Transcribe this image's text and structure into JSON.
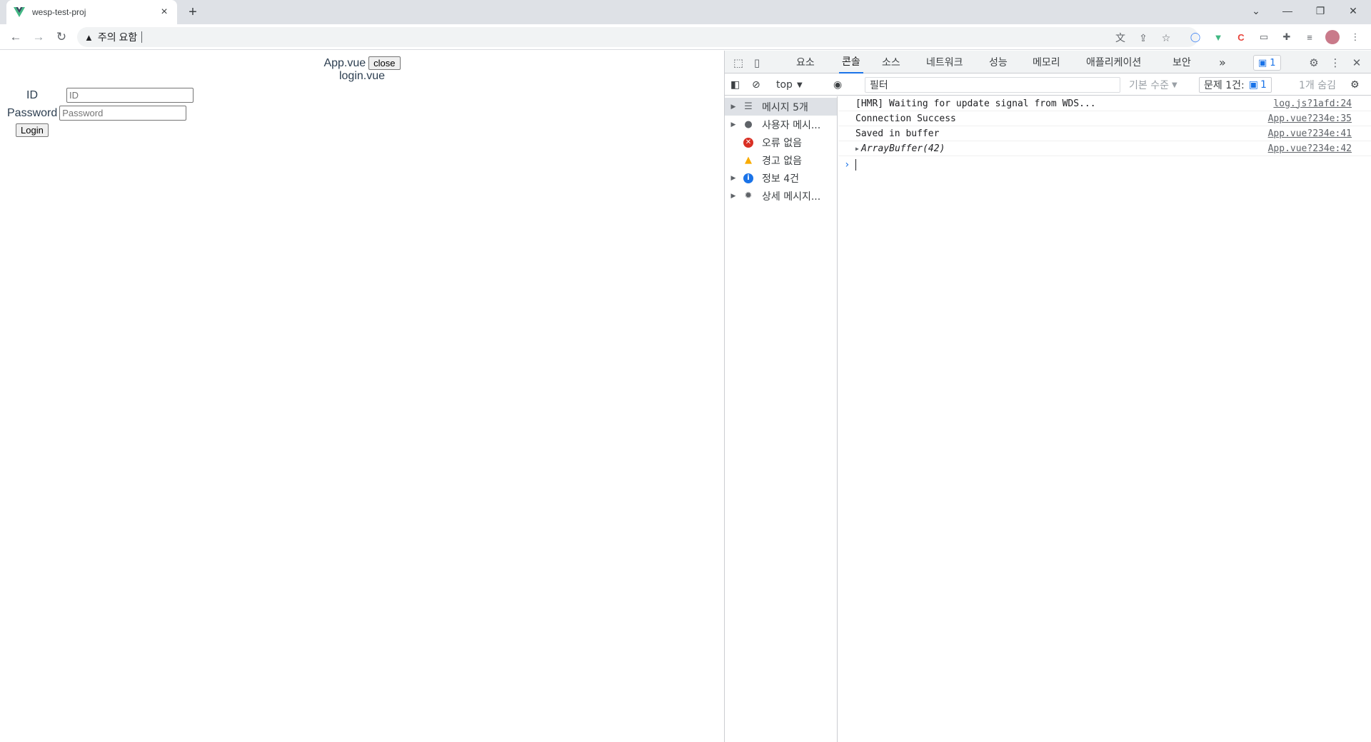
{
  "browser": {
    "tab_title": "wesp-test-proj",
    "new_tab_label": "+",
    "omnibox_warning": "주의 요함",
    "omnibox_url": ""
  },
  "page": {
    "app_title": "App.vue",
    "close_label": "close",
    "subtitle": "login.vue",
    "id_label": "ID",
    "id_placeholder": "ID",
    "password_label": "Password",
    "password_placeholder": "Password",
    "login_label": "Login"
  },
  "devtools": {
    "tabs": [
      "요소",
      "콘솔",
      "소스",
      "네트워크",
      "성능",
      "메모리",
      "애플리케이션",
      "보안"
    ],
    "active_tab": "콘솔",
    "more_tabs": "»",
    "issues_badge_count": "1",
    "filterbar": {
      "context": "top",
      "filter_placeholder": "필터",
      "level": "기본 수준",
      "issues_label": "문제 1건:",
      "issues_count": "1",
      "hidden": "1개 숨김"
    },
    "sidebar": [
      {
        "label": "메시지 5개",
        "icon": "list-icon",
        "expandable": true,
        "selected": true
      },
      {
        "label": "사용자 메시...",
        "icon": "user-icon",
        "expandable": true,
        "selected": false
      },
      {
        "label": "오류 없음",
        "icon": "error-icon",
        "expandable": false,
        "selected": false
      },
      {
        "label": "경고 없음",
        "icon": "warning-icon",
        "expandable": false,
        "selected": false
      },
      {
        "label": "정보 4건",
        "icon": "info-icon",
        "expandable": true,
        "selected": false
      },
      {
        "label": "상세 메시지...",
        "icon": "bug-icon",
        "expandable": true,
        "selected": false
      }
    ],
    "logs": [
      {
        "message": "[HMR] Waiting for update signal from WDS...",
        "source": "log.js?1afd:24"
      },
      {
        "message": "Connection Success",
        "source": "App.vue?234e:35"
      },
      {
        "message": "Saved in buffer",
        "source": "App.vue?234e:41"
      },
      {
        "message": "ArrayBuffer(42)",
        "source": "App.vue?234e:42"
      }
    ]
  },
  "colors": {
    "accent": "#1a73e8",
    "error": "#d93025",
    "warning": "#f9ab00",
    "info": "#1a73e8"
  }
}
